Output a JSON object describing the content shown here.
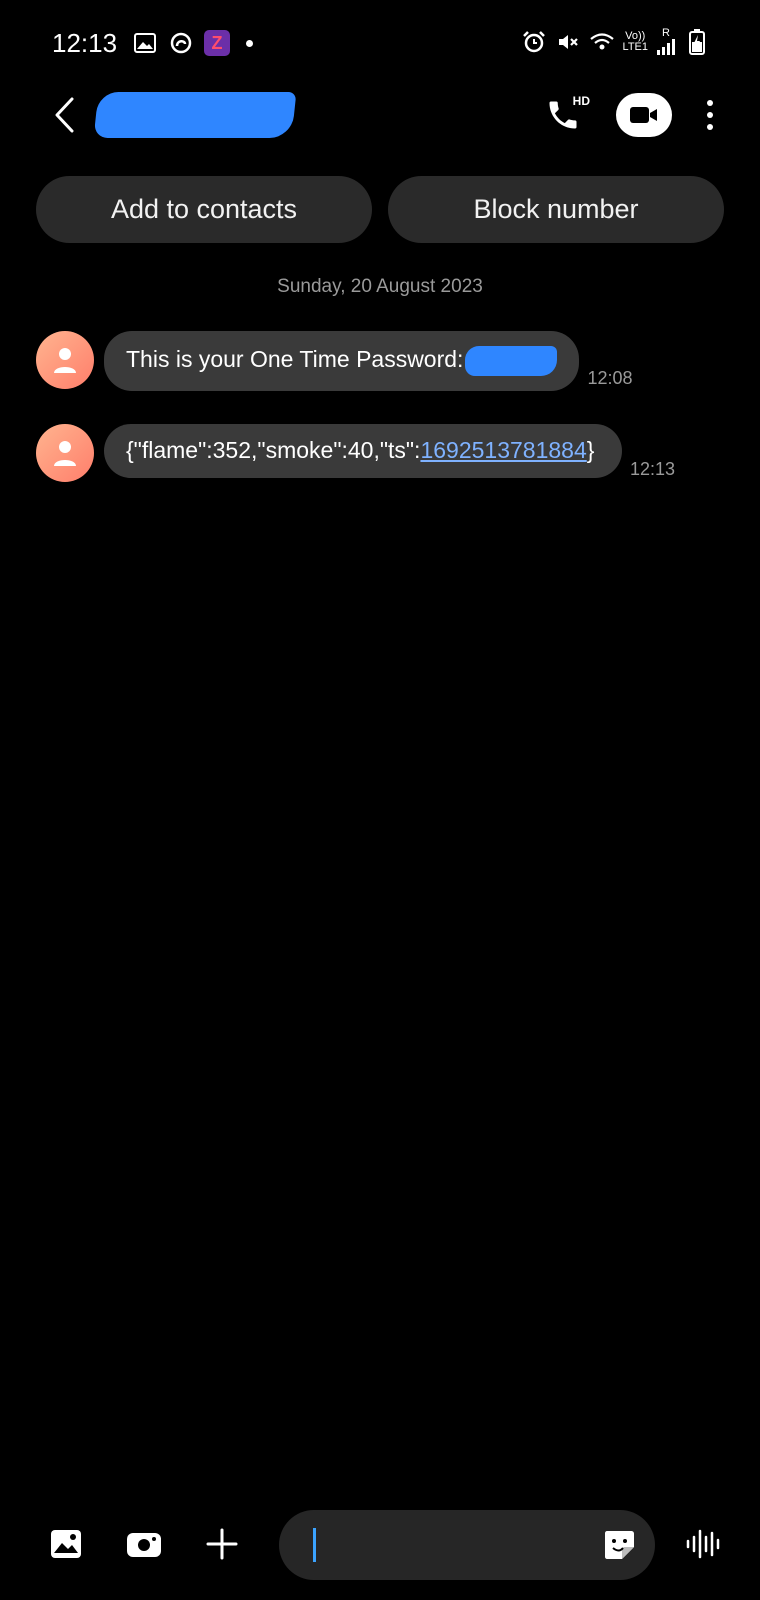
{
  "status_bar": {
    "time": "12:13",
    "left_icons": [
      "gallery-icon",
      "sync-icon",
      "z-app-icon",
      "notification-dot"
    ],
    "z_badge_label": "Z",
    "right_icons": [
      "alarm-icon",
      "mute-icon",
      "wifi-icon",
      "volte-icon",
      "signal-icon",
      "battery-charging-icon"
    ],
    "volte_top": "Vo))",
    "volte_bottom": "LTE1",
    "roaming": "R"
  },
  "header": {
    "contact_name": "",
    "hd_label": "HD",
    "icons": [
      "back-arrow-icon",
      "hd-call-icon",
      "video-call-icon",
      "more-options-icon"
    ]
  },
  "actions": {
    "add_to_contacts": "Add to contacts",
    "block_number": "Block number"
  },
  "conversation": {
    "date": "Sunday, 20 August 2023",
    "messages": [
      {
        "text": "This is your One Time Password:",
        "time": "12:08"
      },
      {
        "text_prefix": "{\"flame\":352,\"smoke\":40,\"ts\":",
        "link": "1692513781884",
        "text_suffix": "}",
        "time": "12:13"
      }
    ]
  },
  "composer": {
    "input_value": "",
    "icons": [
      "gallery-icon",
      "camera-icon",
      "plus-icon",
      "sticker-icon",
      "voice-record-icon"
    ]
  },
  "colors": {
    "background": "#000000",
    "bubble": "#3a3a3a",
    "pill": "#2a2a2a",
    "link": "#7fb2ff",
    "redaction": "#2f86ff",
    "avatar_gradient_start": "#ffb48f",
    "avatar_gradient_end": "#ff7e6b"
  }
}
